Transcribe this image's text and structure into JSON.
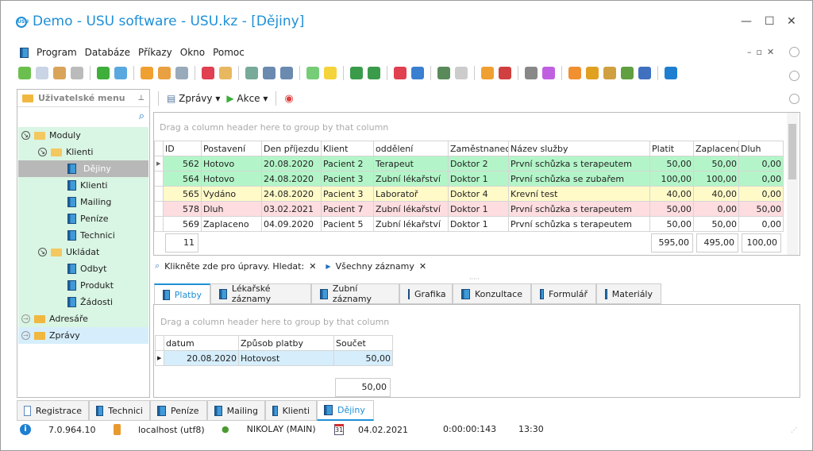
{
  "window": {
    "title": "Demo - USU software - USU.kz - [Dějiny]",
    "logo": "USU",
    "minimize": "—",
    "maximize": "☐",
    "close": "✕"
  },
  "menu": [
    "Program",
    "Databáze",
    "Příkazy",
    "Okno",
    "Pomoc"
  ],
  "toolbar_icons": [
    {
      "name": "add-icon",
      "color": "#6bbf4e"
    },
    {
      "name": "copy-icon",
      "color": "#c9d4e4"
    },
    {
      "name": "edit-icon",
      "color": "#d9a45a"
    },
    {
      "name": "delete-icon",
      "color": "#bbb"
    },
    "sep",
    {
      "name": "refresh-icon",
      "color": "#3fae3a"
    },
    {
      "name": "search-icon",
      "color": "#5aa8e0"
    },
    "sep",
    {
      "name": "filter-icon",
      "color": "#f0a030"
    },
    {
      "name": "filter-clear-icon",
      "color": "#e8a040"
    },
    {
      "name": "filter-settings-icon",
      "color": "#9ab"
    },
    "sep",
    {
      "name": "flag-icon",
      "color": "#e04050"
    },
    {
      "name": "image-icon",
      "color": "#e8b860"
    },
    "sep",
    {
      "name": "columns-icon",
      "color": "#7a9"
    },
    {
      "name": "expand-icon",
      "color": "#6a8ab0"
    },
    {
      "name": "collapse-icon",
      "color": "#6a8ab0"
    },
    "sep",
    {
      "name": "add-column-icon",
      "color": "#7c7"
    },
    {
      "name": "note-icon",
      "color": "#f5d33a"
    },
    "sep",
    {
      "name": "excel-export-icon",
      "color": "#3a9b4a"
    },
    {
      "name": "excel-import-icon",
      "color": "#3a9b4a"
    },
    "sep",
    {
      "name": "new-window-icon",
      "color": "#e04050"
    },
    {
      "name": "window-icon",
      "color": "#3a7fd0"
    },
    "sep",
    {
      "name": "exit-icon",
      "color": "#5a8a5a"
    },
    {
      "name": "arrow-icon",
      "color": "#ccc"
    },
    "sep",
    {
      "name": "location-icon",
      "color": "#f0a030"
    },
    {
      "name": "calendar-icon",
      "color": "#d04040"
    },
    "sep",
    {
      "name": "gear-icon",
      "color": "#888"
    },
    {
      "name": "color-icon",
      "color": "#c060e0"
    },
    "sep",
    {
      "name": "rss-icon",
      "color": "#f09030"
    },
    {
      "name": "lock-icon",
      "color": "#e0a020"
    },
    {
      "name": "user-key-icon",
      "color": "#d0a040"
    },
    {
      "name": "users-icon",
      "color": "#60a040"
    },
    {
      "name": "tools-icon",
      "color": "#4070c0"
    },
    "sep",
    {
      "name": "info-icon",
      "color": "#1e7fd0"
    }
  ],
  "left_panel": {
    "title": "Uživatelské menu",
    "tree": [
      {
        "label": "Moduly",
        "level": 0,
        "type": "group",
        "bg": "#d9f5e3"
      },
      {
        "label": "Klienti",
        "level": 1,
        "type": "group",
        "bg": "#d9f5e3"
      },
      {
        "label": "Dějiny",
        "level": 2,
        "type": "item",
        "bg": "#b8b8b8"
      },
      {
        "label": "Klienti",
        "level": 2,
        "type": "item",
        "bg": "#d9f5e3"
      },
      {
        "label": "Mailing",
        "level": 2,
        "type": "item",
        "bg": "#d9f5e3"
      },
      {
        "label": "Peníze",
        "level": 2,
        "type": "item",
        "bg": "#d9f5e3"
      },
      {
        "label": "Technici",
        "level": 2,
        "type": "item",
        "bg": "#d9f5e3"
      },
      {
        "label": "Ukládat",
        "level": 1,
        "type": "group",
        "bg": "#d9f5e3"
      },
      {
        "label": "Odbyt",
        "level": 2,
        "type": "item",
        "bg": "#d9f5e3"
      },
      {
        "label": "Produkt",
        "level": 2,
        "type": "item",
        "bg": "#d9f5e3"
      },
      {
        "label": "Žádosti",
        "level": 2,
        "type": "item",
        "bg": "#d9f5e3"
      },
      {
        "label": "Adresáře",
        "level": 0,
        "type": "closed",
        "bg": "#d9f5e3"
      },
      {
        "label": "Zprávy",
        "level": 0,
        "type": "closed",
        "bg": "#d6eefc"
      }
    ]
  },
  "actions": {
    "reports": "Zprávy",
    "actions": "Akce"
  },
  "main_grid": {
    "group_hint": "Drag a column header here to group by that column",
    "columns": [
      "ID",
      "Postavení",
      "Den příjezdu",
      "Klient",
      "oddělení",
      "Zaměstnanec",
      "Název služby",
      "Platit",
      "Zaplaceno",
      "Dluh"
    ],
    "rows": [
      {
        "cells": [
          "562",
          "Hotovo",
          "20.08.2020",
          "Pacient 2",
          "Terapeut",
          "Doktor 2",
          "První schůzka s terapeutem",
          "50,00",
          "50,00",
          "0,00"
        ],
        "cls": "g"
      },
      {
        "cells": [
          "564",
          "Hotovo",
          "24.08.2020",
          "Pacient 3",
          "Zubní lékařství",
          "Doktor 1",
          "První schůzka se zubařem",
          "100,00",
          "100,00",
          "0,00"
        ],
        "cls": "g"
      },
      {
        "cells": [
          "565",
          "Vydáno",
          "24.08.2020",
          "Pacient 3",
          "Laboratoř",
          "Doktor 4",
          "Krevní test",
          "40,00",
          "40,00",
          "0,00"
        ],
        "cls": "y"
      },
      {
        "cells": [
          "578",
          "Dluh",
          "03.02.2021",
          "Pacient 7",
          "Zubní lékařství",
          "Doktor 1",
          "První schůzka s terapeutem",
          "50,00",
          "0,00",
          "50,00"
        ],
        "cls": "r"
      },
      {
        "cells": [
          "569",
          "Zaplaceno",
          "04.09.2020",
          "Pacient 5",
          "Zubní lékařství",
          "Doktor 1",
          "První schůzka s terapeutem",
          "50,00",
          "50,00",
          "0,00"
        ],
        "cls": "w"
      }
    ],
    "footer": {
      "count": "11",
      "platit": "595,00",
      "zaplaceno": "495,00",
      "dluh": "100,00"
    },
    "filter": {
      "edit": "Klikněte zde pro úpravy. Hledat:",
      "all": "Všechny záznamy"
    }
  },
  "tabs": [
    "Platby",
    "Lékařské záznamy",
    "Zubní záznamy",
    "Grafika",
    "Konzultace",
    "Formulář",
    "Materiály"
  ],
  "sub_grid": {
    "group_hint": "Drag a column header here to group by that column",
    "columns": [
      "datum",
      "Způsob platby",
      "Součet"
    ],
    "rows": [
      [
        "20.08.2020",
        "Hotovost",
        "50,00"
      ]
    ],
    "total": "50,00"
  },
  "bottom_tabs": [
    "Registrace",
    "Technici",
    "Peníze",
    "Mailing",
    "Klienti",
    "Dějiny"
  ],
  "status": {
    "version": "7.0.964.10",
    "db": "localhost (utf8)",
    "user": "NIKOLAY (MAIN)",
    "cal": "31",
    "date": "04.02.2021",
    "timer": "0:00:00:143",
    "time": "13:30"
  }
}
